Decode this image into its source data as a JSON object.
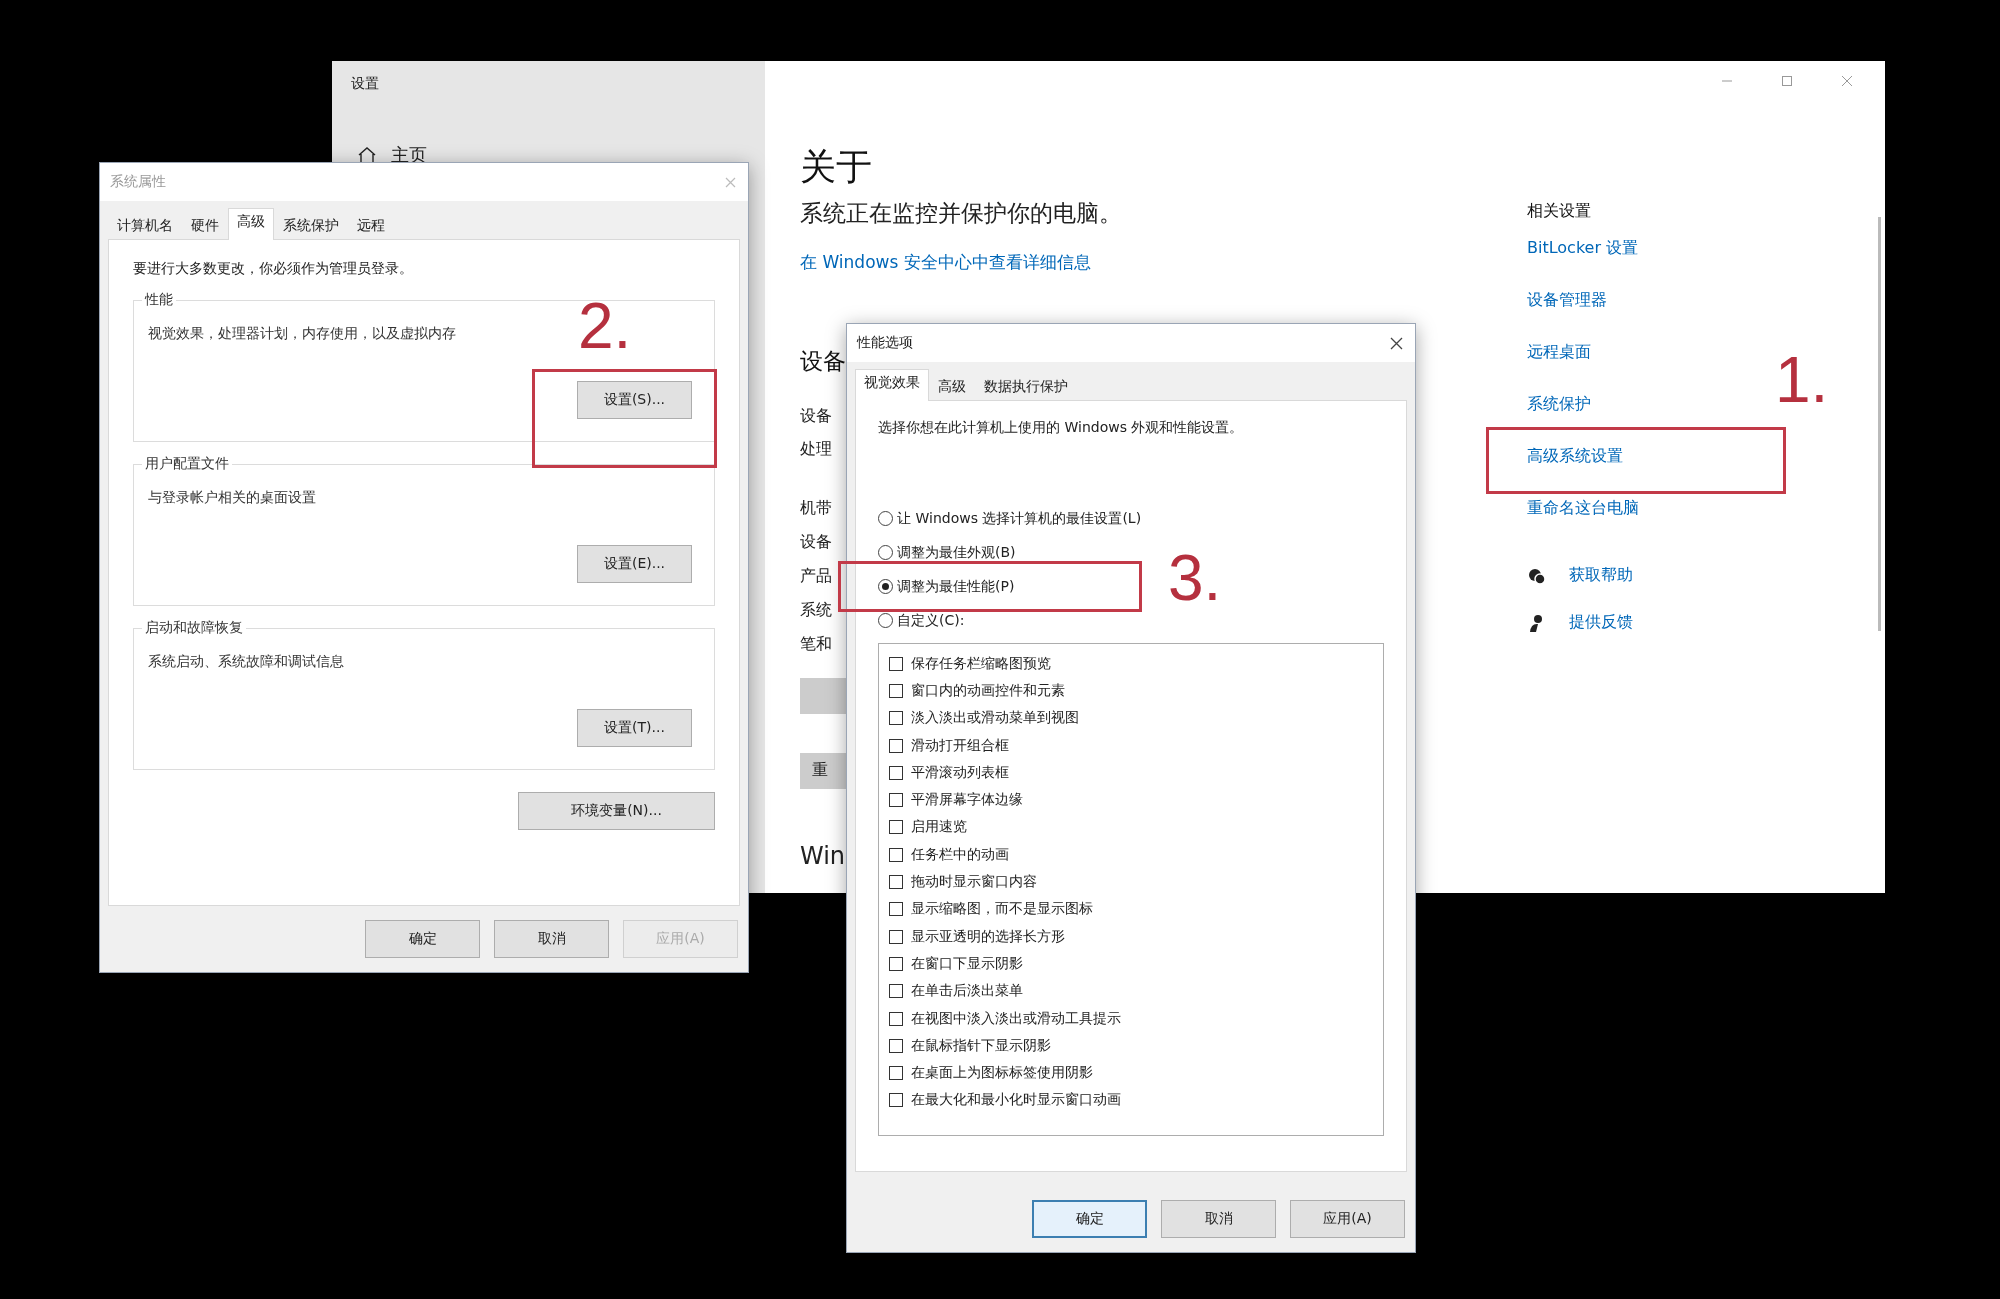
{
  "settings_window": {
    "title": "设置",
    "nav_item": "主页",
    "heading": "关于",
    "status": "系统正在监控并保护你的电脑。",
    "security_link": "在 Windows 安全中心中查看详细信息",
    "section_heading": "设备",
    "spec_labels": [
      "设备",
      "处理",
      "机带",
      "设备",
      "产品",
      "系统",
      "笔和"
    ],
    "rename_button": "重",
    "footer_heading": "Win",
    "related_title": "相关设置",
    "related_links": [
      "BitLocker 设置",
      "设备管理器",
      "远程桌面",
      "系统保护",
      "高级系统设置",
      "重命名这台电脑"
    ],
    "help_links": [
      {
        "kind": "help",
        "label": "获取帮助"
      },
      {
        "kind": "feedback",
        "label": "提供反馈"
      }
    ]
  },
  "system_properties": {
    "title": "系统属性",
    "tabs": [
      {
        "label": "计算机名",
        "selected": false
      },
      {
        "label": "硬件",
        "selected": false
      },
      {
        "label": "高级",
        "selected": true
      },
      {
        "label": "系统保护",
        "selected": false
      },
      {
        "label": "远程",
        "selected": false
      }
    ],
    "notice": "要进行大多数更改，你必须作为管理员登录。",
    "groups": [
      {
        "title": "性能",
        "description": "视觉效果，处理器计划，内存使用，以及虚拟内存",
        "button": "设置(S)..."
      },
      {
        "title": "用户配置文件",
        "description": "与登录帐户相关的桌面设置",
        "button": "设置(E)..."
      },
      {
        "title": "启动和故障恢复",
        "description": "系统启动、系统故障和调试信息",
        "button": "设置(T)..."
      }
    ],
    "env_button": "环境变量(N)...",
    "buttons": [
      {
        "label": "确定",
        "disabled": false
      },
      {
        "label": "取消",
        "disabled": false
      },
      {
        "label": "应用(A)",
        "disabled": true
      }
    ]
  },
  "performance_options": {
    "title": "性能选项",
    "tabs": [
      {
        "label": "视觉效果",
        "selected": true
      },
      {
        "label": "高级",
        "selected": false
      },
      {
        "label": "数据执行保护",
        "selected": false
      }
    ],
    "description": "选择你想在此计算机上使用的 Windows 外观和性能设置。",
    "options": [
      {
        "label": "让 Windows 选择计算机的最佳设置(L)",
        "selected": false
      },
      {
        "label": "调整为最佳外观(B)",
        "selected": false
      },
      {
        "label": "调整为最佳性能(P)",
        "selected": true
      },
      {
        "label": "自定义(C):",
        "selected": false
      }
    ],
    "effects": [
      {
        "label": "保存任务栏缩略图预览",
        "checked": false
      },
      {
        "label": "窗口内的动画控件和元素",
        "checked": false
      },
      {
        "label": "淡入淡出或滑动菜单到视图",
        "checked": false
      },
      {
        "label": "滑动打开组合框",
        "checked": false
      },
      {
        "label": "平滑滚动列表框",
        "checked": false
      },
      {
        "label": "平滑屏幕字体边缘",
        "checked": false
      },
      {
        "label": "启用速览",
        "checked": false
      },
      {
        "label": "任务栏中的动画",
        "checked": false
      },
      {
        "label": "拖动时显示窗口内容",
        "checked": false
      },
      {
        "label": "显示缩略图，而不是显示图标",
        "checked": false
      },
      {
        "label": "显示亚透明的选择长方形",
        "checked": false
      },
      {
        "label": "在窗口下显示阴影",
        "checked": false
      },
      {
        "label": "在单击后淡出菜单",
        "checked": false
      },
      {
        "label": "在视图中淡入淡出或滑动工具提示",
        "checked": false
      },
      {
        "label": "在鼠标指针下显示阴影",
        "checked": false
      },
      {
        "label": "在桌面上为图标标签使用阴影",
        "checked": false
      },
      {
        "label": "在最大化和最小化时显示窗口动画",
        "checked": false
      }
    ],
    "buttons": [
      {
        "label": "确定",
        "default": true
      },
      {
        "label": "取消",
        "default": false
      },
      {
        "label": "应用(A)",
        "default": false
      }
    ]
  },
  "annotations": [
    {
      "label": "1."
    },
    {
      "label": "2."
    },
    {
      "label": "3."
    }
  ]
}
